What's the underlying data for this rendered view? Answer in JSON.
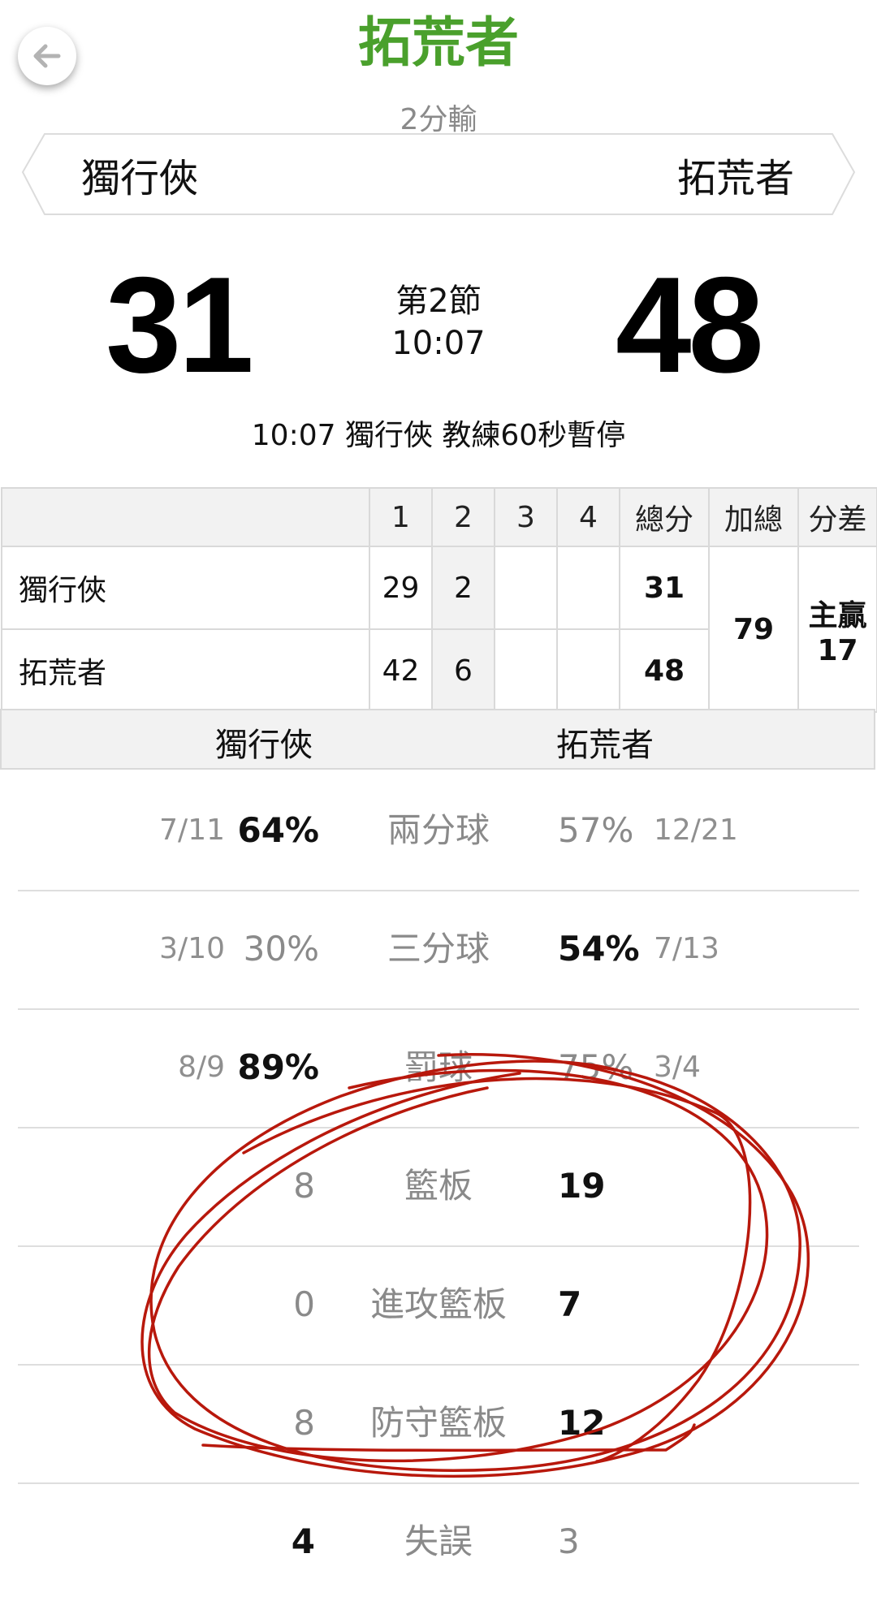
{
  "header": {
    "title": "拓荒者",
    "result": "2分輸"
  },
  "teams": {
    "left": "獨行俠",
    "right": "拓荒者"
  },
  "score": {
    "left": "31",
    "right": "48",
    "period": "第2節",
    "clock": "10:07"
  },
  "last_event": "10:07 獨行俠  教練60秒暫停",
  "box_score": {
    "headers": [
      "",
      "1",
      "2",
      "3",
      "4",
      "總分",
      "加總",
      "分差"
    ],
    "rows": [
      {
        "team": "獨行俠",
        "q": [
          "29",
          "2",
          "",
          ""
        ],
        "total": "31"
      },
      {
        "team": "拓荒者",
        "q": [
          "42",
          "6",
          "",
          ""
        ],
        "total": "48"
      }
    ],
    "combined": "79",
    "diff_label": "主贏",
    "diff_value": "17"
  },
  "stats_header": {
    "left": "獨行俠",
    "right": "拓荒者"
  },
  "stats": [
    {
      "label": "兩分球",
      "left_frac": "7/11",
      "left_pct": "64%",
      "right_pct": "57%",
      "right_frac": "12/21"
    },
    {
      "label": "三分球",
      "left_frac": "3/10",
      "left_pct": "30%",
      "right_pct": "54%",
      "right_frac": "7/13"
    },
    {
      "label": "罰球",
      "left_frac": "8/9",
      "left_pct": "89%",
      "right_pct": "75%",
      "right_frac": "3/4"
    },
    {
      "label": "籃板",
      "left": "8",
      "right": "19"
    },
    {
      "label": "進攻籃板",
      "left": "0",
      "right": "7"
    },
    {
      "label": "防守籃板",
      "left": "8",
      "right": "12"
    },
    {
      "label": "失誤",
      "left": "4",
      "right": "3"
    }
  ],
  "colors": {
    "title": "#4aa02c",
    "annotation": "#b8180c"
  },
  "icons": {
    "back": "arrow-left-icon"
  }
}
